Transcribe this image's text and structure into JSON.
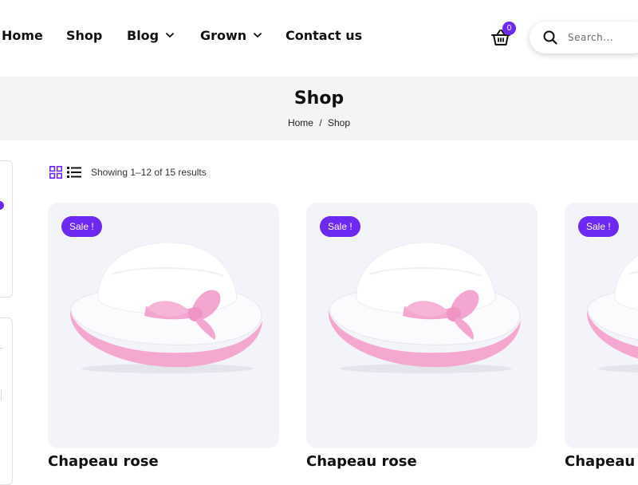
{
  "nav": {
    "items": [
      {
        "label": "Home"
      },
      {
        "label": "Shop"
      },
      {
        "label": "Blog"
      },
      {
        "label": "Grown"
      },
      {
        "label": "Contact us"
      }
    ]
  },
  "cart": {
    "count": "0",
    "icon": "basket-icon"
  },
  "search": {
    "placeholder": "Search..."
  },
  "page": {
    "title": "Shop",
    "breadcrumb": {
      "home": "Home",
      "separator": "/",
      "current": "Shop"
    }
  },
  "toolbar": {
    "grid_icon": "grid-view-icon",
    "list_icon": "list-view-icon",
    "result_count": "Showing 1–12 of 15 results"
  },
  "products": [
    {
      "title": "Chapeau rose",
      "badge": "Sale !"
    },
    {
      "title": "Chapeau rose",
      "badge": "Sale !"
    },
    {
      "title": "Chapeau rose",
      "badge": "Sale !"
    }
  ],
  "colors": {
    "accent": "#6d28f2",
    "card_bg": "#f3f4f9",
    "title_band_bg": "#f4f4f4",
    "hat_pink": "#f3a6cf"
  }
}
